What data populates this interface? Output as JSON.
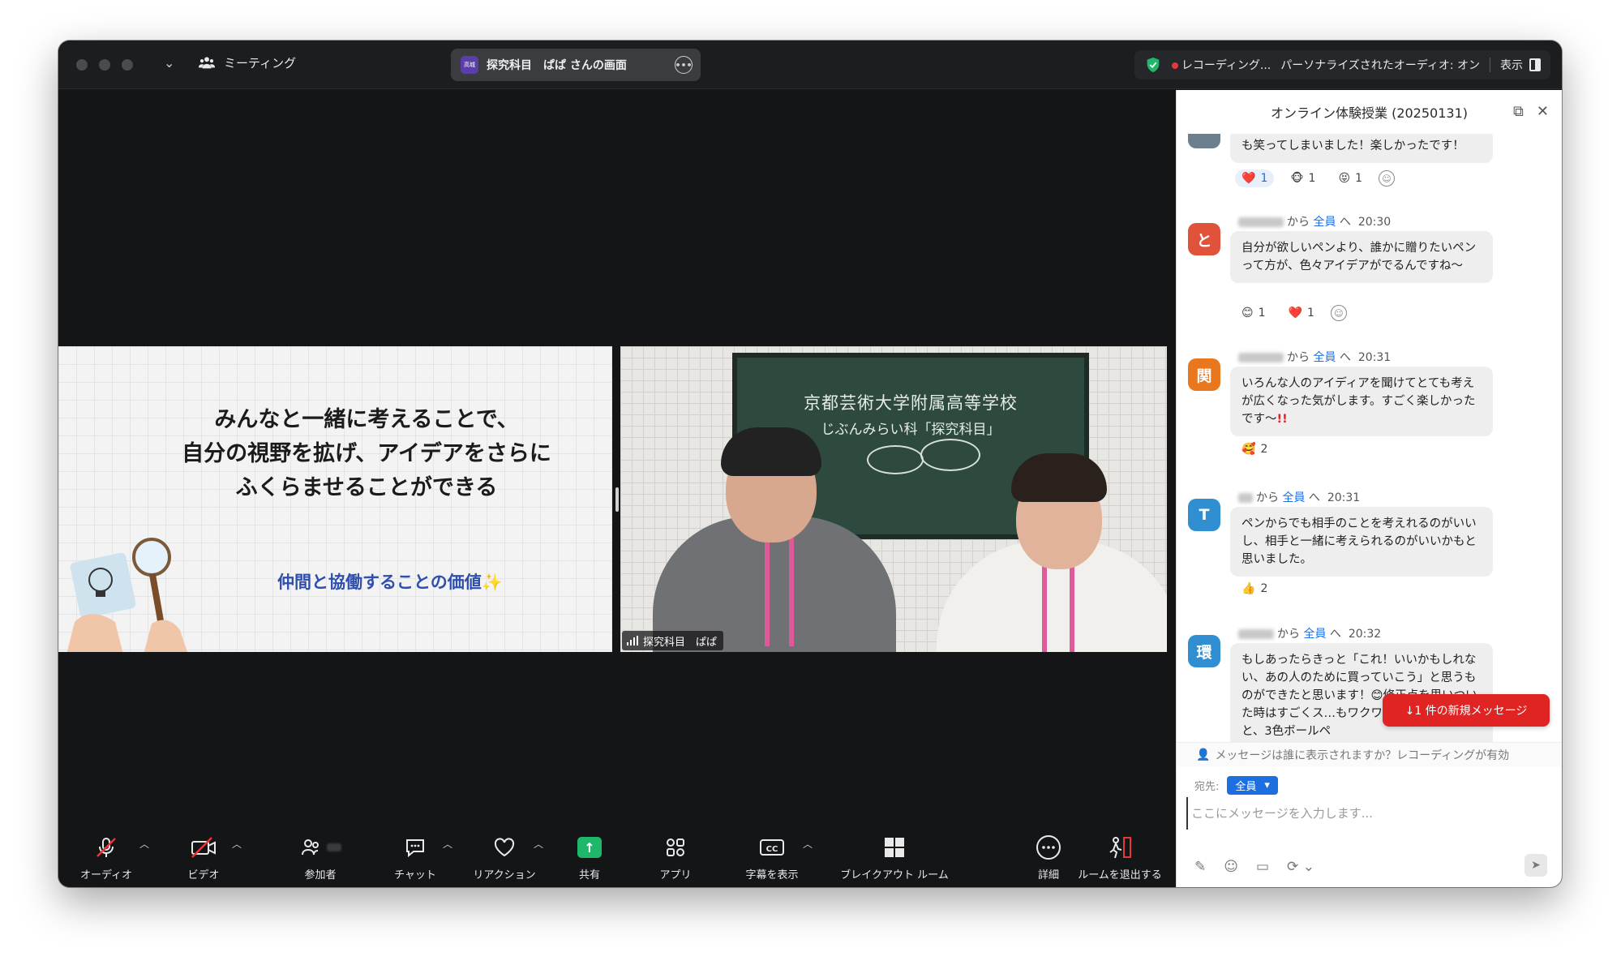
{
  "titlebar": {
    "meeting_label": "ミーティング",
    "share_badge": "高城",
    "share_title": "探究科目　ぱぱ さんの画面",
    "recording": "レコーディング...",
    "audio": "パーソナライズされたオーディオ: オン",
    "view": "表示"
  },
  "slide": {
    "line1": "みんなと一緒に考えることで、",
    "line2": "自分の視野を拡げ、アイデアをさらに",
    "line3": "ふくらませることができる",
    "sub": "仲間と協働することの価値"
  },
  "video": {
    "board_line1": "京都芸術大学附属高等学校",
    "board_line2": "じぶんみらい科「探究科目」",
    "name": "探究科目　ぱぱ"
  },
  "toolbar": {
    "audio": "オーディオ",
    "video": "ビデオ",
    "participants": "参加者",
    "chat": "チャット",
    "reactions": "リアクション",
    "share": "共有",
    "apps": "アプリ",
    "captions": "字幕を表示",
    "breakout": "ブレイクアウト ルーム",
    "more": "詳細",
    "leave_room": "ルームを退出する"
  },
  "chat": {
    "title": "オンライン体験授業 (20250131)",
    "from_word": "から",
    "to_word": "全員",
    "to_suffix": "へ",
    "messages": [
      {
        "text": "も笑ってしまいました！楽しかったです！",
        "reactions": [
          {
            "emoji": "❤️",
            "count": "1",
            "active": true
          },
          {
            "emoji": "🐵",
            "count": "1",
            "active": false
          },
          {
            "emoji": "😝",
            "count": "1",
            "active": false
          }
        ]
      },
      {
        "avatar": "と",
        "color": "#e0533a",
        "time": "20:30",
        "text": "自分が欲しいペンより、誰かに贈りたいペンって方が、色々アイデアがでるんですね〜",
        "reactions": [
          {
            "emoji": "😊",
            "count": "1",
            "active": false
          },
          {
            "emoji": "❤️",
            "count": "1",
            "active": false
          }
        ]
      },
      {
        "avatar": "関",
        "color": "#e8771e",
        "time": "20:31",
        "text": "いろんな人のアイディアを聞けてとても考えが広くなった気がします。すごく楽しかったです〜",
        "exclaim": "!!",
        "reactions": [
          {
            "emoji": "🥰",
            "count": "2",
            "active": false
          }
        ]
      },
      {
        "avatar": "T",
        "color": "#2f8fd0",
        "time": "20:31",
        "text": "ペンからでも相手のことを考えれるのがいいし、相手と一緒に考えられるのがいいかもと思いました。",
        "reactions": [
          {
            "emoji": "👍",
            "count": "2",
            "active": false
          }
        ]
      },
      {
        "avatar": "環",
        "color": "#2f8fd0",
        "time": "20:32",
        "text": "もしあったらきっと「これ！いいかもしれない、あの人のために買っていこう」と思うものができたと思います！😊修正点を思いついた時はすごくス…もワクワクしました！あと、3色ボールペ"
      }
    ],
    "new_message": "↓1 件の新規メッセージ",
    "visibility": "メッセージは誰に表示されますか？レコーディングが有効",
    "recipient_label": "宛先:",
    "recipient_value": "全員",
    "input_placeholder": "ここにメッセージを入力します..."
  }
}
